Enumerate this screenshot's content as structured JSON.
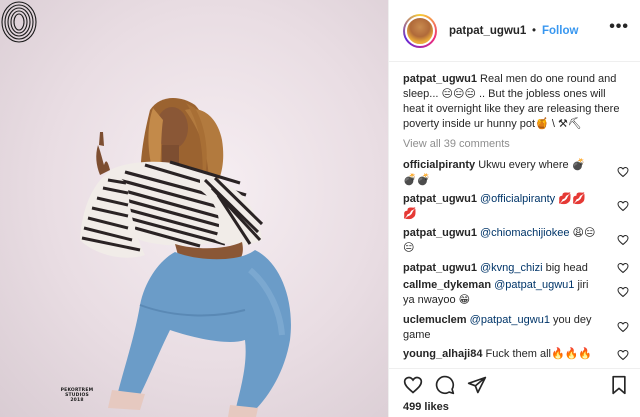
{
  "post": {
    "username": "patpat_ugwu1",
    "dot": "•",
    "follow_label": "Follow",
    "more_label": "•••",
    "watermark_lines": [
      "PEKORTREM",
      "STUDIOS",
      "2018"
    ],
    "caption": {
      "username": "patpat_ugwu1",
      "text": "Real men do one round and sleep... 😑😑😑 .. But the jobless ones will heat it overnight like they are releasing there poverty inside ur hunny pot🍯 \\ ⚒⛏"
    },
    "view_all_label": "View all 39 comments",
    "likes_label": "499 likes"
  },
  "comments": [
    {
      "username": "officialpiranty",
      "mention": "",
      "text": "Ukwu every where 💣💣💣"
    },
    {
      "username": "patpat_ugwu1",
      "mention": "@officialpiranty",
      "text": " 💋💋💋"
    },
    {
      "username": "patpat_ugwu1",
      "mention": "@chiomachijiokee",
      "text": " 😩😑😑"
    },
    {
      "username": "patpat_ugwu1",
      "mention": "@kvng_chizi",
      "text": " big head"
    },
    {
      "username": "callme_dykeman",
      "mention": "@patpat_ugwu1",
      "text": " jiri ya nwayoo 😁"
    },
    {
      "username": "uclemuclem",
      "mention": "@patpat_ugwu1",
      "text": " you dey game"
    },
    {
      "username": "young_alhaji84",
      "mention": "",
      "text": "Fuck them all🔥🔥🔥"
    }
  ],
  "icons": {
    "like": "heart-icon",
    "comment": "comment-icon",
    "share": "share-icon",
    "save": "bookmark-icon",
    "comment_like": "heart-outline-icon"
  },
  "colors": {
    "follow": "#3897f0",
    "text": "#262626",
    "muted": "#8e8e8e",
    "mention": "#003569"
  }
}
